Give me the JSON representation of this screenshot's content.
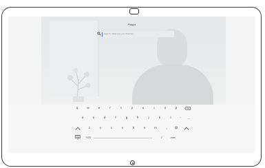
{
  "header": {
    "title": "Połącz"
  },
  "search": {
    "placeholder": "Search, dialer (or) your directory"
  },
  "keyboard": {
    "row1": [
      "q",
      "w",
      "e",
      "r",
      "t",
      "y",
      "u",
      "i",
      "o",
      "p"
    ],
    "row2": [
      "a",
      "s",
      "d",
      "f",
      "g",
      "h",
      "j",
      "k",
      "l",
      "-",
      "_"
    ],
    "row3": [
      "z",
      "x",
      "c",
      "v",
      "b",
      "n",
      "m",
      ",",
      "@"
    ],
    "row4": {
      "numeric_label": "?123",
      "slash": "/",
      "com": ".com"
    },
    "icons": {
      "backspace": "backspace-icon",
      "shift": "shift-icon",
      "shift_right": "chevron-up-icon",
      "hide": "keyboard-hide-icon"
    }
  }
}
